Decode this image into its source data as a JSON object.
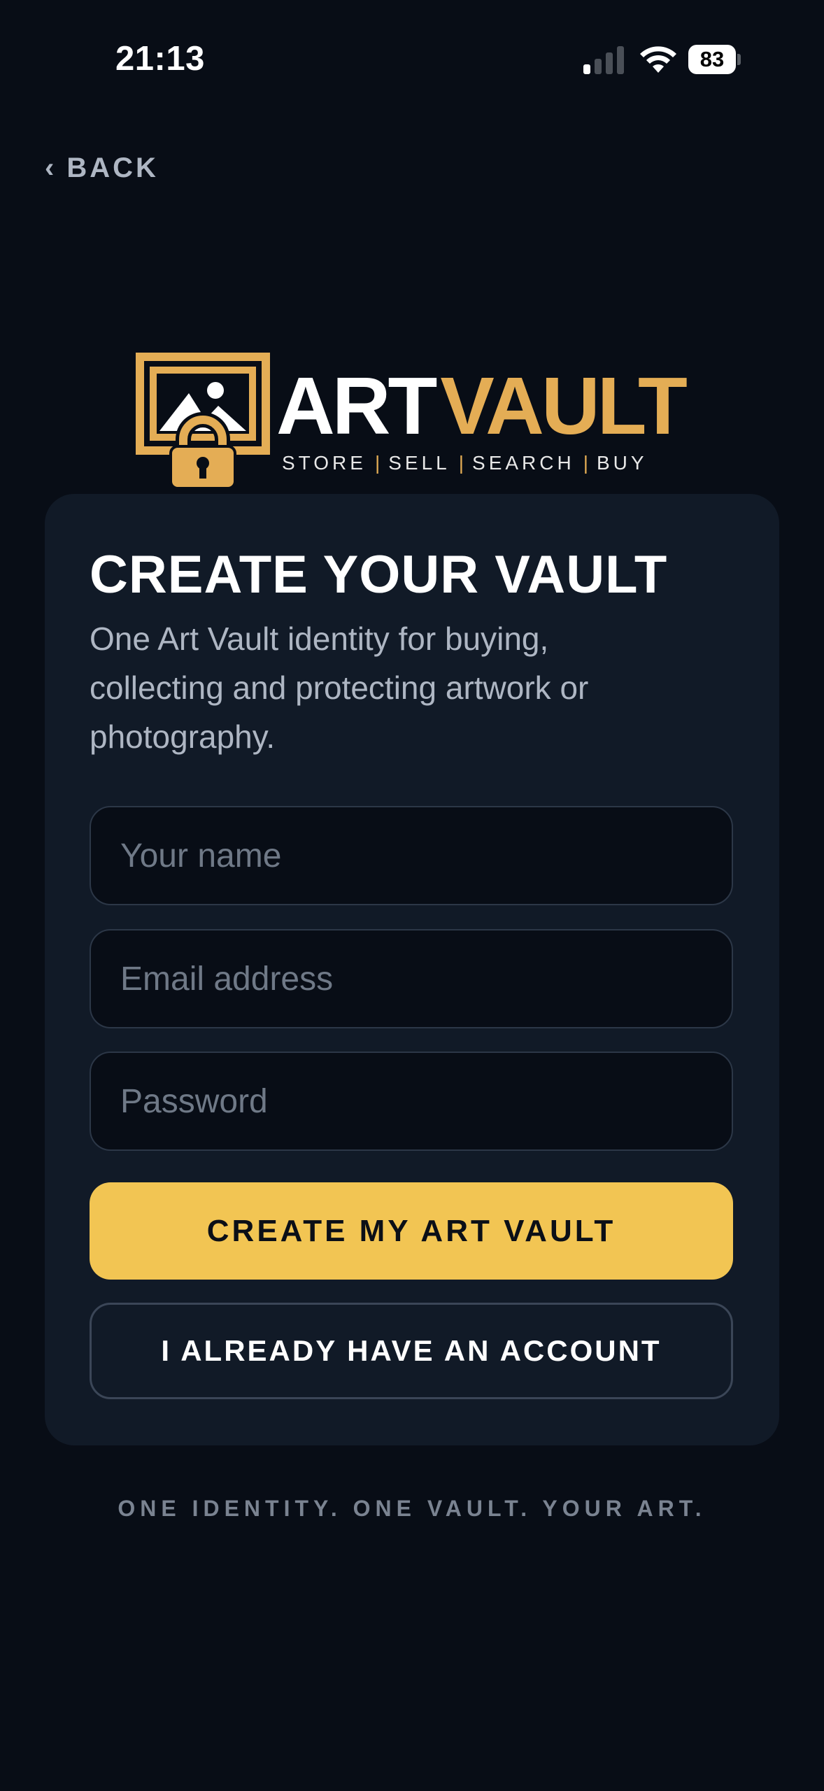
{
  "status_bar": {
    "time": "21:13",
    "battery_percent": "83",
    "icons": [
      "cellular-signal-icon",
      "wifi-icon",
      "battery-icon"
    ]
  },
  "nav": {
    "back_label": "BACK",
    "back_icon": "chevron-left-icon"
  },
  "logo": {
    "word_art": "ART",
    "word_vault": "VAULT",
    "tagline_items": [
      "STORE",
      "SELL",
      "SEARCH",
      "BUY"
    ],
    "icon": "framed-picture-lock-icon"
  },
  "card": {
    "title": "CREATE YOUR VAULT",
    "subtitle": "One Art Vault identity for buying, collecting and protecting artwork or photography.",
    "fields": {
      "name": {
        "placeholder": "Your name",
        "value": ""
      },
      "email": {
        "placeholder": "Email address",
        "value": ""
      },
      "password": {
        "placeholder": "Password",
        "value": ""
      }
    },
    "primary_button": "CREATE MY ART VAULT",
    "secondary_button": "I ALREADY HAVE AN ACCOUNT"
  },
  "footer": {
    "tagline": "ONE IDENTITY. ONE VAULT. YOUR ART."
  },
  "colors": {
    "background": "#080d16",
    "card": "#111a27",
    "accent_gold": "#f2c553",
    "logo_gold": "#e4ad55",
    "muted_text": "#aeb6c3"
  }
}
